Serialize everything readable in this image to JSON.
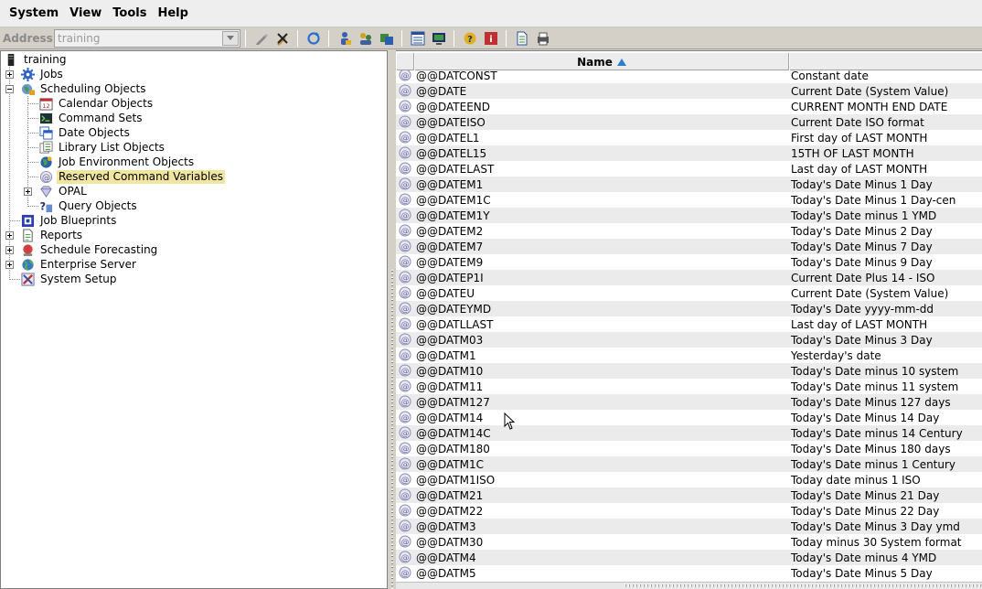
{
  "menu": {
    "items": [
      "System",
      "View",
      "Tools",
      "Help"
    ]
  },
  "toolbar": {
    "address_label": "Address:",
    "address_value": "training"
  },
  "tree": {
    "root": "training",
    "nodes": {
      "jobs": "Jobs",
      "scheduling_objects": "Scheduling Objects",
      "calendar_objects": "Calendar Objects",
      "command_sets": "Command Sets",
      "date_objects": "Date Objects",
      "library_list_objects": "Library List Objects",
      "job_environment_objects": "Job Environment Objects",
      "reserved_command_variables": "Reserved Command Variables",
      "opal": "OPAL",
      "query_objects": "Query Objects",
      "job_blueprints": "Job Blueprints",
      "reports": "Reports",
      "schedule_forecasting": "Schedule Forecasting",
      "enterprise_server": "Enterprise Server",
      "system_setup": "System Setup"
    }
  },
  "list": {
    "columns": {
      "name": "Name",
      "description": ""
    },
    "rows": [
      {
        "name": "@@DATCONST",
        "desc": "Constant date"
      },
      {
        "name": "@@DATE",
        "desc": "Current Date (System Value)"
      },
      {
        "name": "@@DATEEND",
        "desc": "CURRENT MONTH END DATE"
      },
      {
        "name": "@@DATEISO",
        "desc": "Current Date ISO format"
      },
      {
        "name": "@@DATEL1",
        "desc": "First day of LAST MONTH"
      },
      {
        "name": "@@DATEL15",
        "desc": "15TH OF LAST MONTH"
      },
      {
        "name": "@@DATELAST",
        "desc": "Last day of LAST MONTH"
      },
      {
        "name": "@@DATEM1",
        "desc": "Today's Date Minus 1 Day"
      },
      {
        "name": "@@DATEM1C",
        "desc": "Today's Date Minus 1 Day-cen"
      },
      {
        "name": "@@DATEM1Y",
        "desc": "Today's Date minus 1 YMD"
      },
      {
        "name": "@@DATEM2",
        "desc": "Today's Date Minus 2 Day"
      },
      {
        "name": "@@DATEM7",
        "desc": "Today's Date Minus 7 Day"
      },
      {
        "name": "@@DATEM9",
        "desc": "Today's Date Minus 9 Day"
      },
      {
        "name": "@@DATEP1I",
        "desc": "Current Date Plus 14 - ISO"
      },
      {
        "name": "@@DATEU",
        "desc": "Current Date (System Value)"
      },
      {
        "name": "@@DATEYMD",
        "desc": "Today's Date yyyy-mm-dd"
      },
      {
        "name": "@@DATLLAST",
        "desc": "Last day of LAST MONTH"
      },
      {
        "name": "@@DATM03",
        "desc": "Today's Date Minus 3 Day"
      },
      {
        "name": "@@DATM1",
        "desc": "Yesterday's date"
      },
      {
        "name": "@@DATM10",
        "desc": "Today's Date minus 10 system"
      },
      {
        "name": "@@DATM11",
        "desc": "Today's Date minus 11 system"
      },
      {
        "name": "@@DATM127",
        "desc": "Today's Date Minus 127 days"
      },
      {
        "name": "@@DATM14",
        "desc": "Today's Date Minus 14 Day"
      },
      {
        "name": "@@DATM14C",
        "desc": "Today's Date minus 14 Century"
      },
      {
        "name": "@@DATM180",
        "desc": "Today's Date Minus 180 days"
      },
      {
        "name": "@@DATM1C",
        "desc": "Today's Date minus 1 Century"
      },
      {
        "name": "@@DATM1ISO",
        "desc": "Today date minus 1 ISO"
      },
      {
        "name": "@@DATM21",
        "desc": "Today's Date Minus 21 Day"
      },
      {
        "name": "@@DATM22",
        "desc": "Today's Date Minus 22 Day"
      },
      {
        "name": "@@DATM3",
        "desc": "Today's Date Minus 3 Day ymd"
      },
      {
        "name": "@@DATM30",
        "desc": "Today minus 30 System format"
      },
      {
        "name": "@@DATM4",
        "desc": "Today's Date minus 4 YMD"
      },
      {
        "name": "@@DATM5",
        "desc": "Today's Date Minus 5 Day"
      }
    ]
  },
  "colors": {
    "selection": "#f0e6a0",
    "sort_arrow": "#2a7fd0",
    "row_alt": "#ebebeb"
  }
}
